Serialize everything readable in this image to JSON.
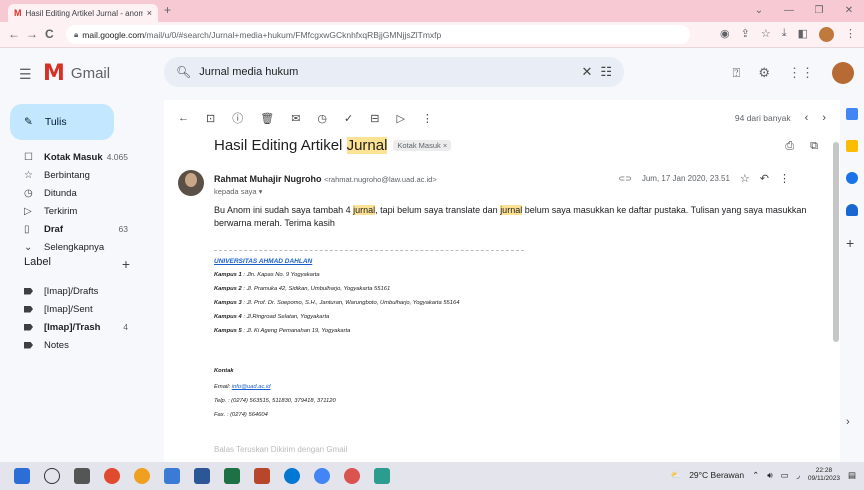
{
  "browser": {
    "tab_title": "Hasil Editing Artikel Jurnal - anom",
    "tab_close": "×",
    "new_tab": "+",
    "url_host": "mail.google.com",
    "url_path": "/mail/u/0/#search/Jurnal+media+hukum/FMfcgxwGCknhfxqRBjjGMNjjsZlTmxfp",
    "back": "←",
    "forward": "→",
    "reload": "C"
  },
  "gmail": {
    "logo_text": "Gmail",
    "search_value": "Jurnal media hukum",
    "compose_label": "Tulis",
    "nav": [
      {
        "icon": "☐",
        "label": "Kotak Masuk",
        "count": "4.065",
        "bold": true
      },
      {
        "icon": "☆",
        "label": "Berbintang",
        "count": "",
        "bold": false
      },
      {
        "icon": "◷",
        "label": "Ditunda",
        "count": "",
        "bold": false
      },
      {
        "icon": "▷",
        "label": "Terkirim",
        "count": "",
        "bold": false
      },
      {
        "icon": "▯",
        "label": "Draf",
        "count": "63",
        "bold": true
      },
      {
        "icon": "⌄",
        "label": "Selengkapnya",
        "count": "",
        "bold": false
      }
    ],
    "label_header": "Label",
    "labels": [
      {
        "label": "[Imap]/Drafts",
        "count": "",
        "bold": false
      },
      {
        "label": "[Imap]/Sent",
        "count": "",
        "bold": false
      },
      {
        "label": "[Imap]/Trash",
        "count": "4",
        "bold": true
      },
      {
        "label": "Notes",
        "count": "",
        "bold": false
      }
    ]
  },
  "email": {
    "pager_count": "94 dari banyak",
    "subject_pre": "Hasil Editing Artikel ",
    "subject_hl": "Jurnal",
    "badge": "Kotak Masuk ×",
    "sender_name": "Rahmat Muhajir Nugroho",
    "sender_email": "<rahmat.nugroho@law.uad.ac.id>",
    "to": "kepada saya ▾",
    "date": "Jum, 17 Jan 2020, 23.51",
    "body_1": "Bu Anom ini sudah saya tambah 4 ",
    "body_hl1": "jurnal",
    "body_2": ", tapi belum saya translate dan ",
    "body_hl2": "jurnal",
    "body_3": " belum saya masukkan ke daftar pustaka. Tulisan yang saya masukkan berwarna merah. Terima kasih",
    "signature": {
      "uni": "UNIVERSITAS AHMAD DAHLAN",
      "k1_b": "Kampus 1",
      "k1": ": Jln. Kapas No. 9 Yogyakarta",
      "k2_b": "Kampus 2",
      "k2": ": Jl. Pramuka 42, Sidikan, Umbulharjo, Yogyakarta 55161",
      "k3_b": "Kampus 3",
      "k3": ": Jl. Prof. Dr. Soepomo, S.H., Janturan, Warungboto, Umbulharjo, Yogyakarta 55164",
      "k4_b": "Kampus 4",
      "k4": ": Jl.Ringroad Selatan, Yogyakarta",
      "k5_b": "Kampus 5",
      "k5": ": Jl. Ki Ageng Pemanahan 19, Yogyakarta",
      "kontak": "Kontak",
      "email_lbl": "Email: ",
      "email_val": "info@uad.ac.id",
      "telp": "Telp. : (0274) 563515, 511830, 379418, 371120",
      "fax": "Fax. : (0274) 564604"
    },
    "footer_peek": "Balas    Teruskan    Dikirim dengan Gmail"
  },
  "taskbar": {
    "weather": "29°C Berawan",
    "time": "22:28",
    "date": "09/11/2023"
  },
  "colors": {
    "tabbar": "#f7c9d3",
    "compose": "#c2e7ff",
    "highlight": "#fde293",
    "gmail_red": "#d93025"
  }
}
